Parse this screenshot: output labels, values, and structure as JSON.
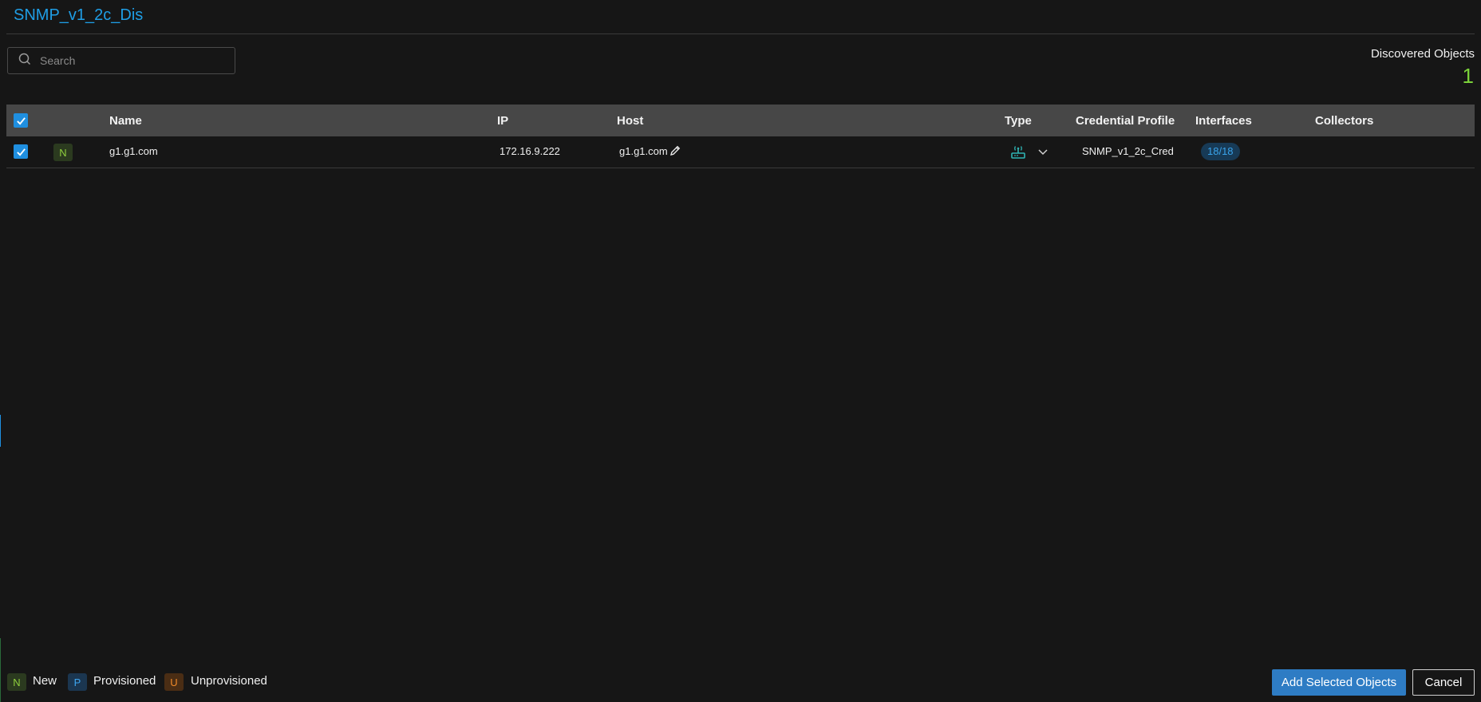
{
  "header": {
    "title": "SNMP_v1_2c_Dis"
  },
  "search": {
    "placeholder": "Search",
    "value": ""
  },
  "summary": {
    "label": "Discovered Objects",
    "count": "1"
  },
  "table": {
    "columns": [
      "Name",
      "IP",
      "Host",
      "Type",
      "Credential Profile",
      "Interfaces",
      "Collectors"
    ],
    "header_checked": true,
    "rows": [
      {
        "checked": true,
        "status": "N",
        "name": "g1.g1.com",
        "ip": "172.16.9.222",
        "host": "g1.g1.com",
        "type_icon": "router-icon",
        "credential_profile": "SNMP_v1_2c_Cred",
        "interfaces": "18/18",
        "collectors": ""
      }
    ]
  },
  "legend": [
    {
      "letter": "N",
      "label": "New"
    },
    {
      "letter": "P",
      "label": "Provisioned"
    },
    {
      "letter": "U",
      "label": "Unprovisioned"
    }
  ],
  "actions": {
    "add_label": "Add Selected Objects",
    "cancel_label": "Cancel"
  },
  "colors": {
    "accent": "#1f9ee6",
    "new": "#8fcf3e",
    "provisioned": "#3ea5f0",
    "unprovisioned": "#f08a2a",
    "count": "#7bd23a"
  }
}
